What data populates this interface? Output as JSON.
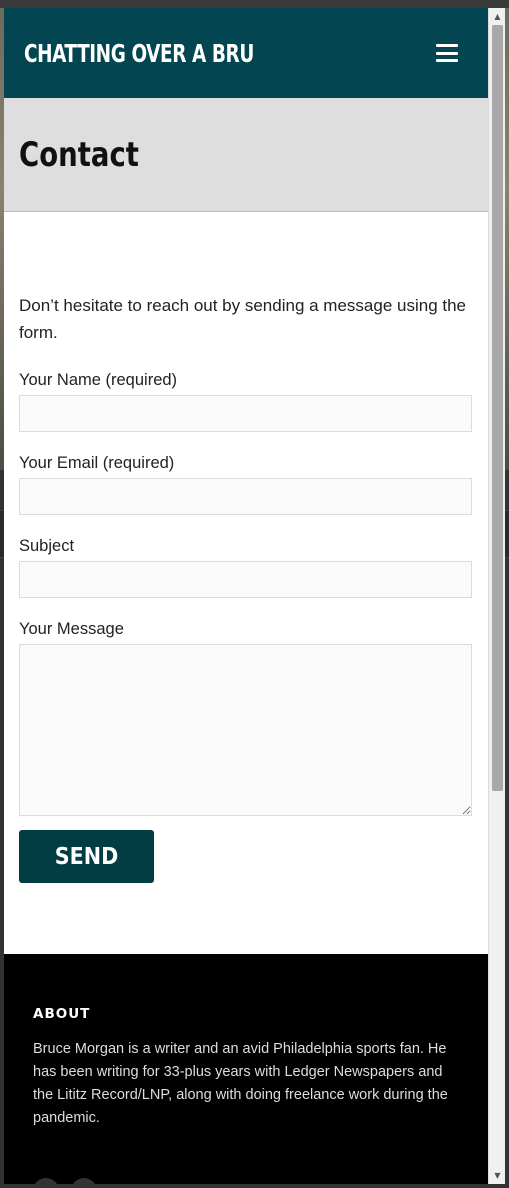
{
  "header": {
    "site_title": "CHATTING OVER A BRU",
    "menu_icon": "hamburger-menu-icon",
    "brand_color": "#034651"
  },
  "page": {
    "title": "Contact"
  },
  "form": {
    "intro": "Don’t hesitate to reach out by sending a message using the form.",
    "name_label": "Your Name (required)",
    "name_value": "",
    "email_label": "Your Email (required)",
    "email_value": "",
    "subject_label": "Subject",
    "subject_value": "",
    "message_label": "Your Message",
    "message_value": "",
    "send_label": "SEND",
    "button_color": "#033d44"
  },
  "footer": {
    "about_heading": "ABOUT",
    "about_text": "Bruce Morgan is a writer and an avid Philadelphia sports fan. He has been writing for 33-plus years with Ledger Newspapers and the Lititz Record/LNP, along with doing freelance work during the pandemic."
  }
}
